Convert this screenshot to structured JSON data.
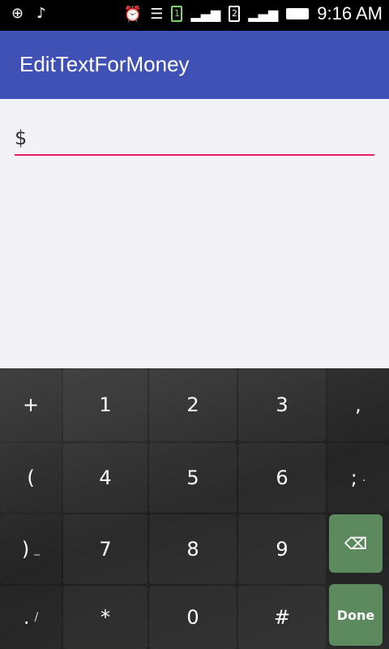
{
  "status_bar": {
    "time": "9:16 AM",
    "sim1": "1",
    "sim2": "2",
    "icons": [
      "notification-plus-icon",
      "music-icon",
      "alarm-icon",
      "wifi-icon",
      "signal-icon",
      "battery-icon"
    ]
  },
  "app_bar": {
    "title": "EditTextForMoney"
  },
  "money_input": {
    "value": "$"
  },
  "keyboard": {
    "rows": [
      [
        "+",
        "1",
        "2",
        "3",
        ","
      ],
      [
        "(",
        "4",
        "5",
        "6",
        ";"
      ],
      [
        ")",
        "7",
        "8",
        "9",
        ""
      ],
      [
        ".",
        "*",
        "0",
        "#",
        "Done"
      ]
    ],
    "secondary": {
      "row2_last": ".",
      "row3_first": "_",
      "row4_first": "/"
    }
  },
  "colors": {
    "accent": "#e91e63",
    "primary": "#3f51b5",
    "action_key": "#5c8a5e"
  }
}
